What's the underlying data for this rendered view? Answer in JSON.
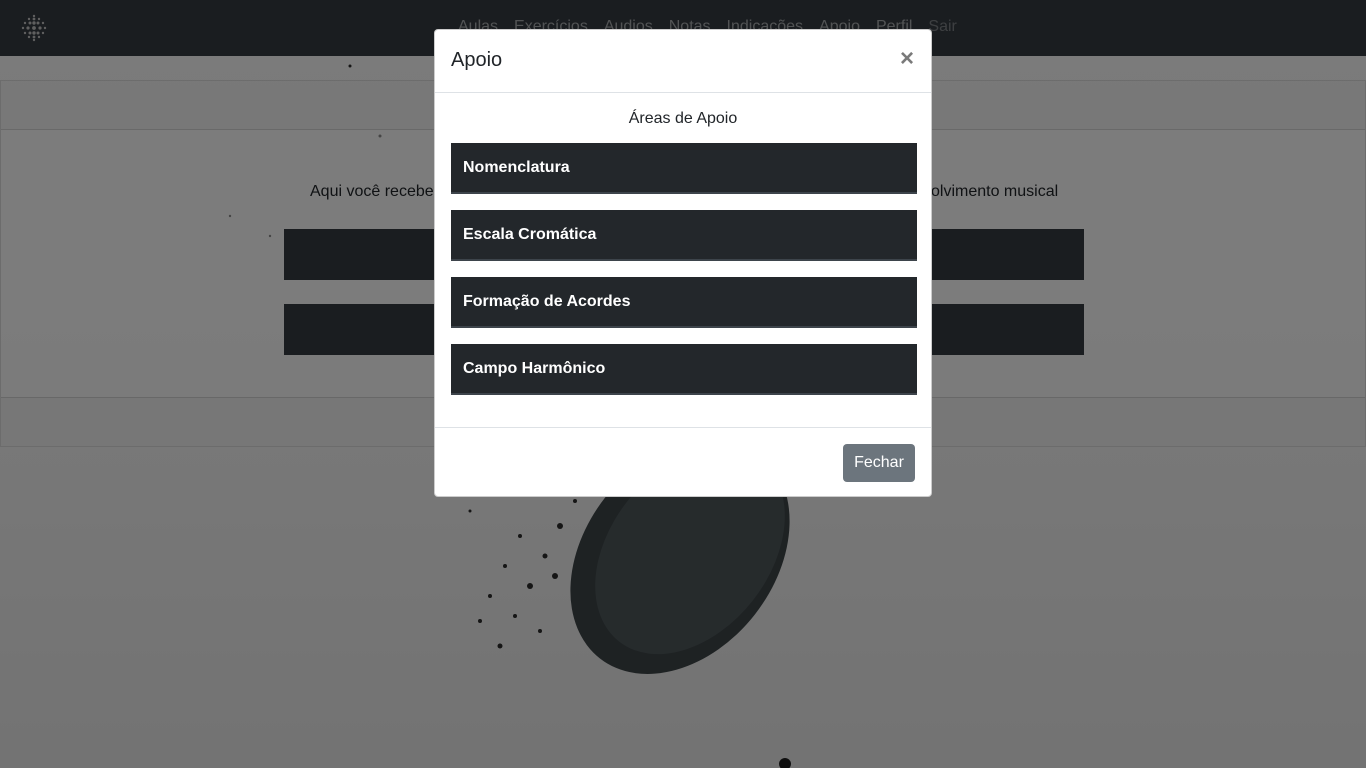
{
  "navbar": {
    "links": [
      {
        "label": "Aulas"
      },
      {
        "label": "Exercícios"
      },
      {
        "label": "Audios"
      },
      {
        "label": "Notas"
      },
      {
        "label": "Indicações"
      },
      {
        "label": "Apoio"
      },
      {
        "label": "Perfil"
      },
      {
        "label": "Sair"
      }
    ]
  },
  "page": {
    "intro_left": "Aqui você recebe",
    "intro_right": "olvimento musical"
  },
  "modal": {
    "title": "Apoio",
    "close_symbol": "×",
    "section_title": "Áreas de Apoio",
    "areas": [
      {
        "label": "Nomenclatura"
      },
      {
        "label": "Escala Cromática"
      },
      {
        "label": "Formação de Acordes"
      },
      {
        "label": "Campo Harmônico"
      }
    ],
    "close_button": "Fechar"
  },
  "colors": {
    "navbar": "#343a40",
    "area_button": "#23272b",
    "secondary_button": "#6c757d"
  },
  "icons": {
    "brand": "dotted-sphere-logo",
    "close": "close-icon"
  }
}
